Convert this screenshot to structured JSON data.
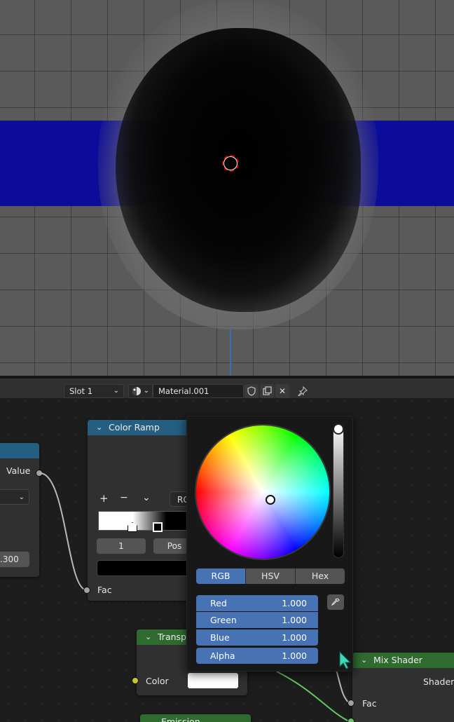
{
  "viewport": {},
  "node_header": {
    "slot_label": "Slot 1",
    "material_name": "Material.001"
  },
  "left_node": {
    "value_label": "Value",
    "value_field": ".300"
  },
  "color_ramp": {
    "title": "Color Ramp",
    "add_label": "+",
    "remove_label": "−",
    "menu_label": "⌄",
    "mode_label": "RG",
    "index_value": "1",
    "pos_label": "Pos",
    "fac_label": "Fac"
  },
  "transparent": {
    "title": "Transp",
    "color_label": "Color"
  },
  "emission": {
    "title": "Emission"
  },
  "mix_shader": {
    "title": "Mix Shader",
    "shader_label": "Shader",
    "fac_label": "Fac"
  },
  "color_picker": {
    "tabs": [
      "RGB",
      "HSV",
      "Hex"
    ],
    "active_tab": "RGB",
    "channels": [
      {
        "label": "Red",
        "value": "1.000"
      },
      {
        "label": "Green",
        "value": "1.000"
      },
      {
        "label": "Blue",
        "value": "1.000"
      },
      {
        "label": "Alpha",
        "value": "1.000"
      }
    ]
  },
  "colors": {
    "accent": "#4772b3",
    "converter_header": "#245e80",
    "shader_header": "#2f6b2f",
    "socket_gray": "#a1a1a1",
    "socket_yellow": "#c7c729",
    "mouse_cursor": "#3ed8b8"
  }
}
